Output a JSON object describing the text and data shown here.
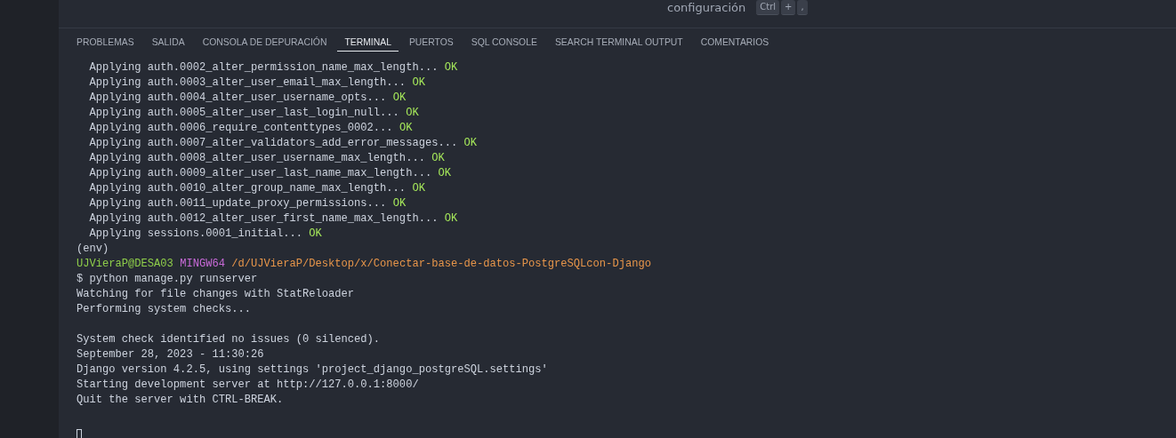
{
  "header": {
    "title": "configuración",
    "keys": [
      "Ctrl",
      "+",
      ","
    ]
  },
  "tabs": [
    {
      "label": "PROBLEMAS",
      "selected": false
    },
    {
      "label": "SALIDA",
      "selected": false
    },
    {
      "label": "CONSOLA DE DEPURACIÓN",
      "selected": false
    },
    {
      "label": "TERMINAL",
      "selected": true
    },
    {
      "label": "PUERTOS",
      "selected": false
    },
    {
      "label": "SQL CONSOLE",
      "selected": false
    },
    {
      "label": "SEARCH TERMINAL OUTPUT",
      "selected": false
    },
    {
      "label": "COMENTARIOS",
      "selected": false
    }
  ],
  "terminal": {
    "lines": [
      {
        "kind": "text",
        "segments": [
          {
            "kind": "plain",
            "text": "  Applying auth.0002_alter_permission_name_max_length... "
          },
          {
            "kind": "ok",
            "text": "OK"
          }
        ]
      },
      {
        "kind": "text",
        "segments": [
          {
            "kind": "plain",
            "text": "  Applying auth.0003_alter_user_email_max_length... "
          },
          {
            "kind": "ok",
            "text": "OK"
          }
        ]
      },
      {
        "kind": "text",
        "segments": [
          {
            "kind": "plain",
            "text": "  Applying auth.0004_alter_user_username_opts... "
          },
          {
            "kind": "ok",
            "text": "OK"
          }
        ]
      },
      {
        "kind": "text",
        "segments": [
          {
            "kind": "plain",
            "text": "  Applying auth.0005_alter_user_last_login_null... "
          },
          {
            "kind": "ok",
            "text": "OK"
          }
        ]
      },
      {
        "kind": "text",
        "segments": [
          {
            "kind": "plain",
            "text": "  Applying auth.0006_require_contenttypes_0002... "
          },
          {
            "kind": "ok",
            "text": "OK"
          }
        ]
      },
      {
        "kind": "text",
        "segments": [
          {
            "kind": "plain",
            "text": "  Applying auth.0007_alter_validators_add_error_messages... "
          },
          {
            "kind": "ok",
            "text": "OK"
          }
        ]
      },
      {
        "kind": "text",
        "segments": [
          {
            "kind": "plain",
            "text": "  Applying auth.0008_alter_user_username_max_length... "
          },
          {
            "kind": "ok",
            "text": "OK"
          }
        ]
      },
      {
        "kind": "text",
        "segments": [
          {
            "kind": "plain",
            "text": "  Applying auth.0009_alter_user_last_name_max_length... "
          },
          {
            "kind": "ok",
            "text": "OK"
          }
        ]
      },
      {
        "kind": "text",
        "segments": [
          {
            "kind": "plain",
            "text": "  Applying auth.0010_alter_group_name_max_length... "
          },
          {
            "kind": "ok",
            "text": "OK"
          }
        ]
      },
      {
        "kind": "text",
        "segments": [
          {
            "kind": "plain",
            "text": "  Applying auth.0011_update_proxy_permissions... "
          },
          {
            "kind": "ok",
            "text": "OK"
          }
        ]
      },
      {
        "kind": "text",
        "segments": [
          {
            "kind": "plain",
            "text": "  Applying auth.0012_alter_user_first_name_max_length... "
          },
          {
            "kind": "ok",
            "text": "OK"
          }
        ]
      },
      {
        "kind": "text",
        "segments": [
          {
            "kind": "plain",
            "text": "  Applying sessions.0001_initial... "
          },
          {
            "kind": "ok",
            "text": "OK"
          }
        ]
      },
      {
        "kind": "text",
        "segments": [
          {
            "kind": "plain",
            "text": "(env)"
          }
        ]
      },
      {
        "kind": "text",
        "segments": [
          {
            "kind": "user",
            "text": "UJVieraP@DESA03 "
          },
          {
            "kind": "shell",
            "text": "MINGW64 "
          },
          {
            "kind": "path",
            "text": "/d/UJVieraP/Desktop/x/Conectar-base-de-datos-PostgreSQLcon-Django"
          }
        ]
      },
      {
        "kind": "text",
        "segments": [
          {
            "kind": "plain",
            "text": "$ python manage.py runserver"
          }
        ]
      },
      {
        "kind": "text",
        "segments": [
          {
            "kind": "plain",
            "text": "Watching for file changes with StatReloader"
          }
        ]
      },
      {
        "kind": "text",
        "segments": [
          {
            "kind": "plain",
            "text": "Performing system checks..."
          }
        ]
      },
      {
        "kind": "blank"
      },
      {
        "kind": "text",
        "segments": [
          {
            "kind": "plain",
            "text": "System check identified no issues (0 silenced)."
          }
        ]
      },
      {
        "kind": "text",
        "segments": [
          {
            "kind": "plain",
            "text": "September 28, 2023 - 11:30:26"
          }
        ]
      },
      {
        "kind": "text",
        "segments": [
          {
            "kind": "plain",
            "text": "Django version 4.2.5, using settings 'project_django_postgreSQL.settings'"
          }
        ]
      },
      {
        "kind": "text",
        "segments": [
          {
            "kind": "plain",
            "text": "Starting development server at http://127.0.0.1:8000/"
          }
        ]
      },
      {
        "kind": "text",
        "segments": [
          {
            "kind": "plain",
            "text": "Quit the server with CTRL-BREAK."
          }
        ]
      },
      {
        "kind": "blank"
      },
      {
        "kind": "cursor"
      }
    ]
  }
}
